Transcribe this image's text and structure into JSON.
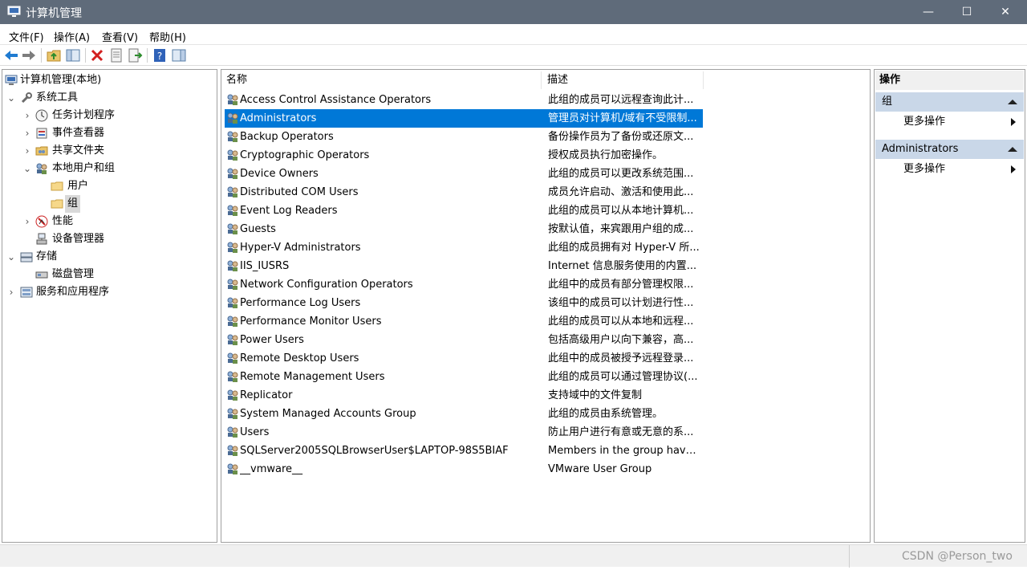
{
  "window": {
    "title": "计算机管理",
    "controls": {
      "minimize": "—",
      "maximize": "☐",
      "close": "✕"
    }
  },
  "menu": [
    "文件(F)",
    "操作(A)",
    "查看(V)",
    "帮助(H)"
  ],
  "toolbar": [
    "back-arrow-icon",
    "forward-arrow-icon",
    "up-folder-icon",
    "show-hide-tree-icon",
    "delete-icon",
    "properties-icon",
    "export-list-icon",
    "help-icon",
    "show-hide-action-pane-icon"
  ],
  "tree": [
    {
      "label": "计算机管理(本地)",
      "expander": "",
      "icon": "computer-management-icon"
    },
    {
      "label": "系统工具",
      "expander": "⌄",
      "icon": "system-tools-icon"
    },
    {
      "label": "任务计划程序",
      "expander": "›",
      "icon": "task-scheduler-icon"
    },
    {
      "label": "事件查看器",
      "expander": "›",
      "icon": "event-viewer-icon"
    },
    {
      "label": "共享文件夹",
      "expander": "›",
      "icon": "shared-folders-icon"
    },
    {
      "label": "本地用户和组",
      "expander": "⌄",
      "icon": "local-users-groups-icon"
    },
    {
      "label": "用户",
      "expander": "",
      "icon": "folder-icon"
    },
    {
      "label": "组",
      "expander": "",
      "icon": "folder-icon"
    },
    {
      "label": "性能",
      "expander": "›",
      "icon": "performance-icon"
    },
    {
      "label": "设备管理器",
      "expander": "",
      "icon": "device-manager-icon"
    },
    {
      "label": "存储",
      "expander": "⌄",
      "icon": "storage-icon"
    },
    {
      "label": "磁盘管理",
      "expander": "",
      "icon": "disk-management-icon"
    },
    {
      "label": "服务和应用程序",
      "expander": "›",
      "icon": "services-apps-icon"
    }
  ],
  "list": {
    "headers": {
      "name": "名称",
      "description": "描述"
    },
    "rows": [
      {
        "name": "Access Control Assistance Operators",
        "desc": "此组的成员可以远程查询此计..."
      },
      {
        "name": "Administrators",
        "desc": "管理员对计算机/域有不受限制..."
      },
      {
        "name": "Backup Operators",
        "desc": "备份操作员为了备份或还原文..."
      },
      {
        "name": "Cryptographic Operators",
        "desc": "授权成员执行加密操作。"
      },
      {
        "name": "Device Owners",
        "desc": "此组的成员可以更改系统范围..."
      },
      {
        "name": "Distributed COM Users",
        "desc": "成员允许启动、激活和使用此..."
      },
      {
        "name": "Event Log Readers",
        "desc": "此组的成员可以从本地计算机..."
      },
      {
        "name": "Guests",
        "desc": "按默认值，来宾跟用户组的成..."
      },
      {
        "name": "Hyper-V Administrators",
        "desc": "此组的成员拥有对 Hyper-V 所..."
      },
      {
        "name": "IIS_IUSRS",
        "desc": "Internet 信息服务使用的内置..."
      },
      {
        "name": "Network Configuration Operators",
        "desc": "此组中的成员有部分管理权限..."
      },
      {
        "name": "Performance Log Users",
        "desc": "该组中的成员可以计划进行性..."
      },
      {
        "name": "Performance Monitor Users",
        "desc": "此组的成员可以从本地和远程..."
      },
      {
        "name": "Power Users",
        "desc": "包括高级用户以向下兼容，高..."
      },
      {
        "name": "Remote Desktop Users",
        "desc": "此组中的成员被授予远程登录..."
      },
      {
        "name": "Remote Management Users",
        "desc": "此组的成员可以通过管理协议(..."
      },
      {
        "name": "Replicator",
        "desc": "支持域中的文件复制"
      },
      {
        "name": "System Managed Accounts Group",
        "desc": "此组的成员由系统管理。"
      },
      {
        "name": "Users",
        "desc": "防止用户进行有意或无意的系..."
      },
      {
        "name": "SQLServer2005SQLBrowserUser$LAPTOP-98S5BIAF",
        "desc": "Members in the group have ..."
      },
      {
        "name": "__vmware__",
        "desc": "VMware User Group"
      }
    ]
  },
  "actions": {
    "title": "操作",
    "sections": [
      {
        "label": "组",
        "more": "更多操作"
      },
      {
        "label": "Administrators",
        "more": "更多操作"
      }
    ]
  },
  "status": {
    "watermark": "CSDN @Person_two"
  },
  "colors": {
    "titlebar": "#5f6b7a",
    "selection": "#0078d7",
    "section_header": "#c9d7e8"
  }
}
